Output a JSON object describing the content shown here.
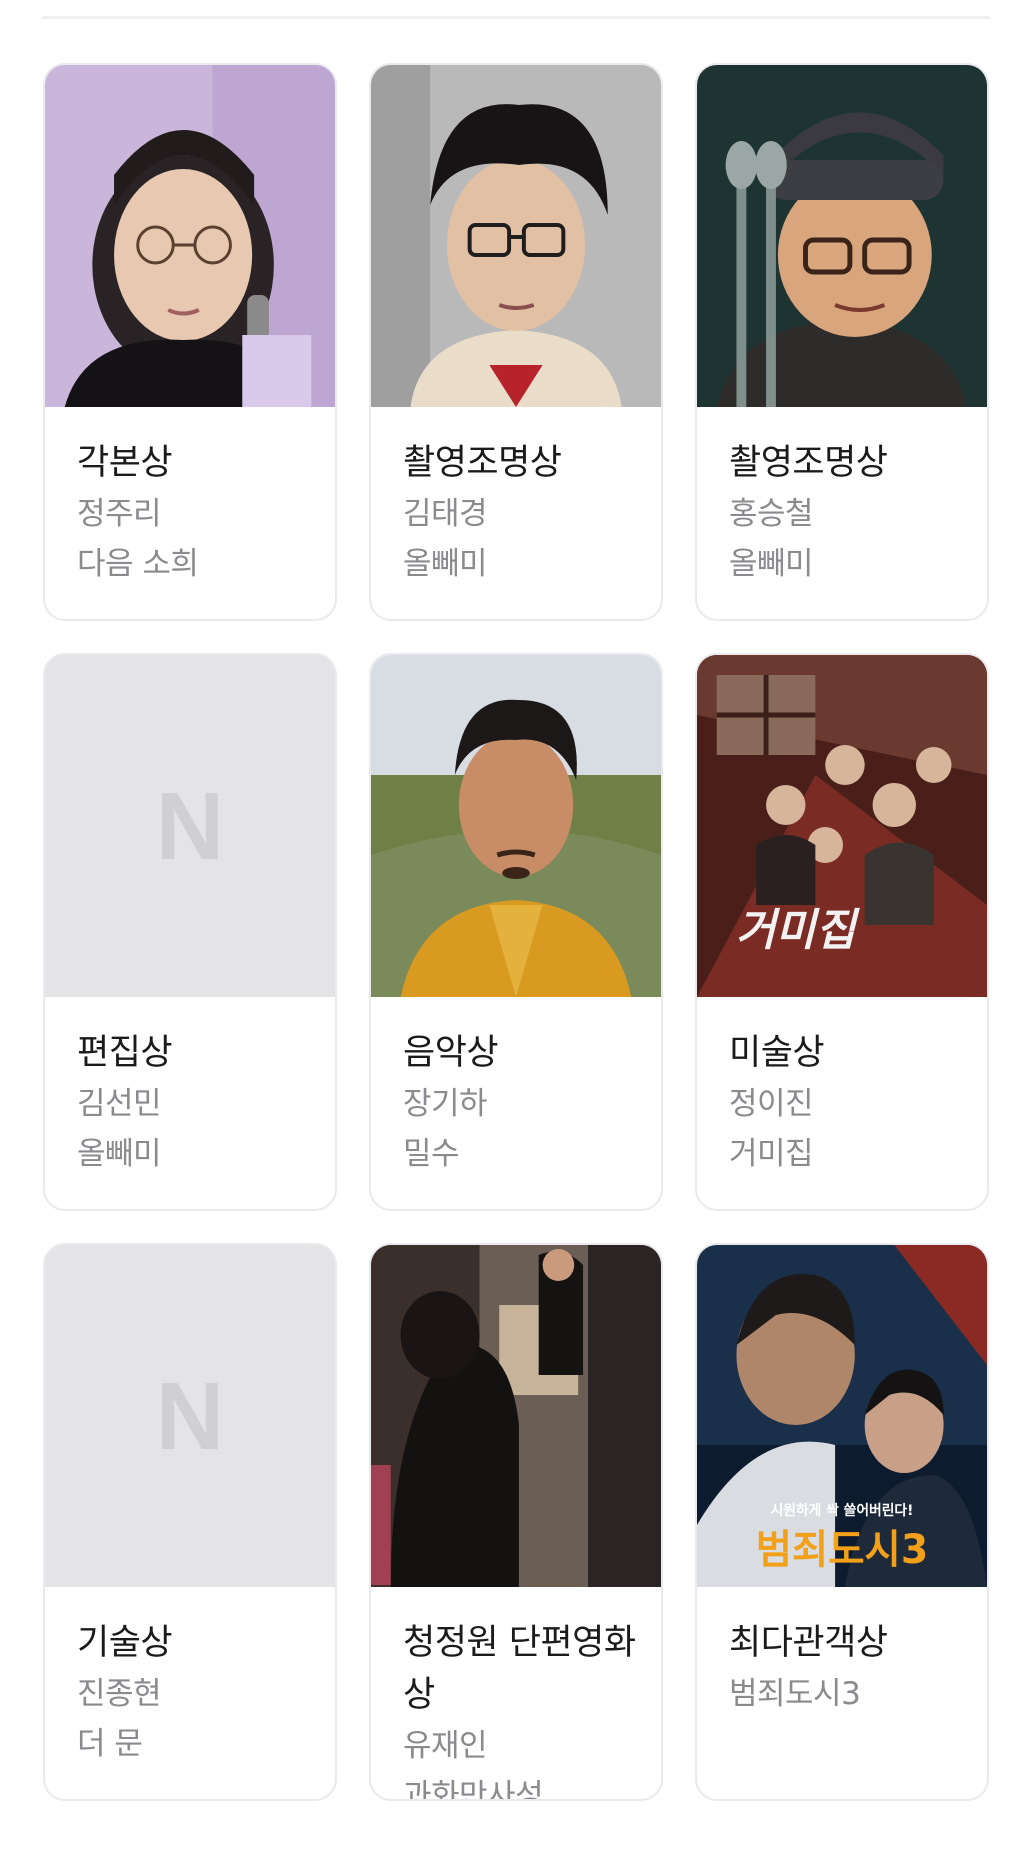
{
  "awards": [
    {
      "award": "각본상",
      "person": "정주리",
      "film": "다음 소희",
      "image": "photo"
    },
    {
      "award": "촬영조명상",
      "person": "김태경",
      "film": "올빼미",
      "image": "photo"
    },
    {
      "award": "촬영조명상",
      "person": "홍승철",
      "film": "올빼미",
      "image": "photo"
    },
    {
      "award": "편집상",
      "person": "김선민",
      "film": "올빼미",
      "image": "placeholder",
      "placeholder_logo": "N"
    },
    {
      "award": "음악상",
      "person": "장기하",
      "film": "밀수",
      "image": "photo"
    },
    {
      "award": "미술상",
      "person": "정이진",
      "film": "거미집",
      "image": "poster",
      "poster_title": "거미집"
    },
    {
      "award": "기술상",
      "person": "진종현",
      "film": "더 문",
      "image": "placeholder",
      "placeholder_logo": "N"
    },
    {
      "award": "청정원 단편영화상",
      "person": "유재인",
      "film": "과화만사성",
      "image": "photo"
    },
    {
      "award": "최다관객상",
      "person": "범죄도시3",
      "film": "",
      "image": "poster",
      "poster_title": "범죄도시3",
      "poster_tagline": "시원하게 싹 쓸어버린다!"
    }
  ],
  "colors": {
    "card_border": "#e9e9ee",
    "title_text": "#1b1b1b",
    "sub_text": "#8a8a8f",
    "placeholder_bg": "#e4e4e7",
    "placeholder_logo": "#cfcfd4"
  }
}
